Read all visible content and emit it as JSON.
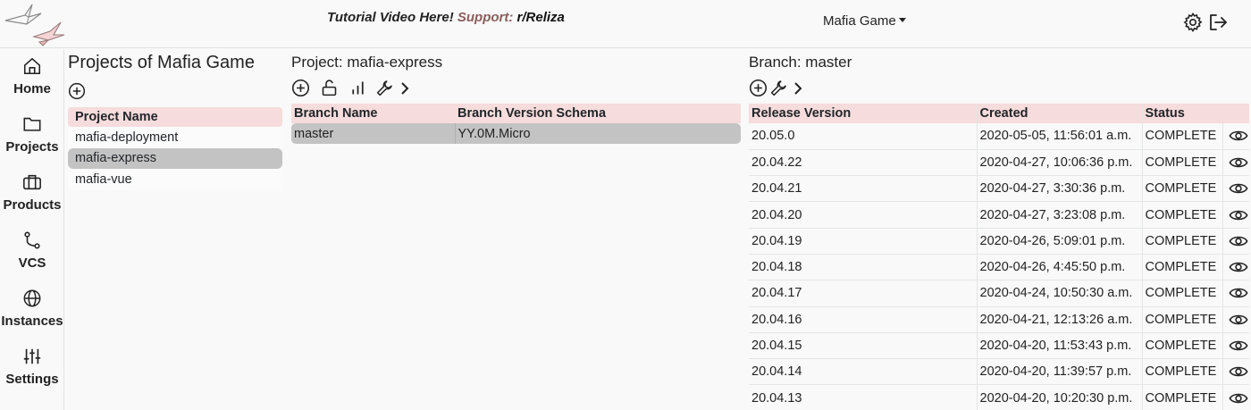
{
  "header": {
    "banner_link": "Tutorial Video Here!",
    "banner_support": "Support:",
    "banner_sub": "r/Reliza",
    "org_selected": "Mafia Game",
    "icons": [
      "gear-icon",
      "logout-icon"
    ]
  },
  "sidebar": {
    "items": [
      {
        "label": "Home",
        "icon": "home-icon"
      },
      {
        "label": "Projects",
        "icon": "folder-icon"
      },
      {
        "label": "Products",
        "icon": "briefcase-icon"
      },
      {
        "label": "VCS",
        "icon": "git-branch-icon"
      },
      {
        "label": "Instances",
        "icon": "globe-icon"
      },
      {
        "label": "Settings",
        "icon": "sliders-icon"
      }
    ]
  },
  "projects_panel": {
    "title": "Projects of Mafia Game",
    "column": "Project Name",
    "rows": [
      "mafia-deployment",
      "mafia-express",
      "mafia-vue"
    ],
    "selected": "mafia-express"
  },
  "project_panel": {
    "title": "Project: mafia-express",
    "columns": [
      "Branch Name",
      "Branch Version Schema"
    ],
    "rows": [
      [
        "master",
        "YY.0M.Micro"
      ]
    ]
  },
  "branch_panel": {
    "title": "Branch: master",
    "columns": [
      "Release Version",
      "Created",
      "Status"
    ],
    "rows": [
      [
        "20.05.0",
        "2020-05-05, 11:56:01 a.m.",
        "COMPLETE"
      ],
      [
        "20.04.22",
        "2020-04-27, 10:06:36 p.m.",
        "COMPLETE"
      ],
      [
        "20.04.21",
        "2020-04-27, 3:30:36 p.m.",
        "COMPLETE"
      ],
      [
        "20.04.20",
        "2020-04-27, 3:23:08 p.m.",
        "COMPLETE"
      ],
      [
        "20.04.19",
        "2020-04-26, 5:09:01 p.m.",
        "COMPLETE"
      ],
      [
        "20.04.18",
        "2020-04-26, 4:45:50 p.m.",
        "COMPLETE"
      ],
      [
        "20.04.17",
        "2020-04-24, 10:50:30 a.m.",
        "COMPLETE"
      ],
      [
        "20.04.16",
        "2020-04-21, 12:13:26 a.m.",
        "COMPLETE"
      ],
      [
        "20.04.15",
        "2020-04-20, 11:53:43 p.m.",
        "COMPLETE"
      ],
      [
        "20.04.14",
        "2020-04-20, 11:39:57 p.m.",
        "COMPLETE"
      ],
      [
        "20.04.13",
        "2020-04-20, 10:20:30 p.m.",
        "COMPLETE"
      ]
    ]
  },
  "colors": {
    "header_row": "#f6dcdc",
    "selected_row": "#c3c3c3",
    "support_text": "#8a5d5d"
  }
}
